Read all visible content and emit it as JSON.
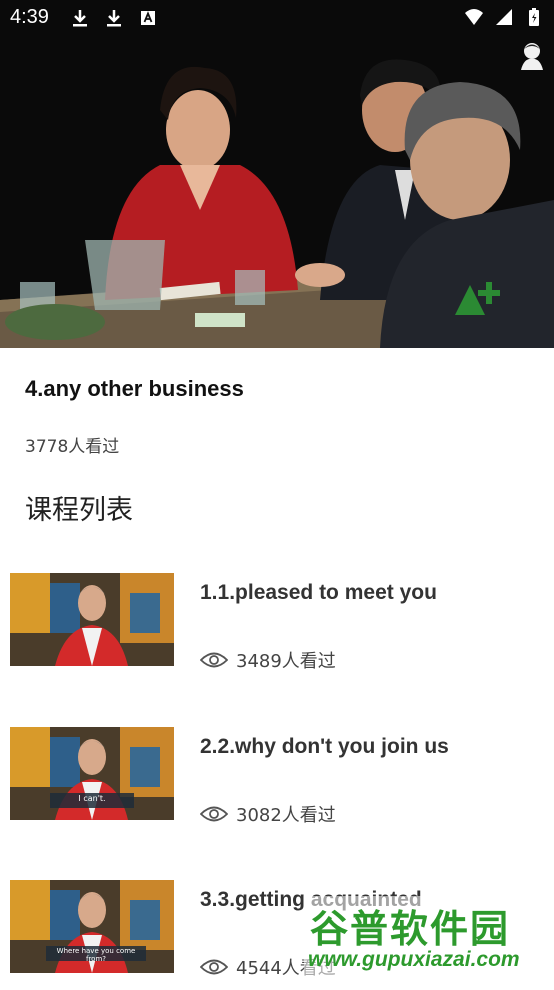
{
  "status_bar": {
    "time": "4:39",
    "left_icons": [
      "download-icon",
      "download-icon",
      "font-icon"
    ],
    "right_icons": [
      "wifi-icon",
      "signal-icon",
      "battery-icon"
    ]
  },
  "video": {
    "player_avatar_icon": "user-avatar-icon",
    "logo_icon": "a-plus-logo-icon"
  },
  "lesson": {
    "title": "4.any other business",
    "views": "3778人看过"
  },
  "course_list": {
    "heading": "课程列表",
    "items": [
      {
        "title": "1.1.pleased to meet you",
        "views": "3489人看过",
        "thumb_caption": ""
      },
      {
        "title": "2.2.why don't you join us",
        "views": "3082人看过",
        "thumb_caption": "I can't."
      },
      {
        "title": "3.3.getting acquainted",
        "views": "4544人看过",
        "thumb_caption": "Where have you come from?"
      }
    ]
  },
  "watermark": {
    "text": "谷普软件园",
    "url": "www.gupuxiazai.com"
  },
  "colors": {
    "accent_green": "#2d9a2d",
    "text_dark": "#111111"
  }
}
